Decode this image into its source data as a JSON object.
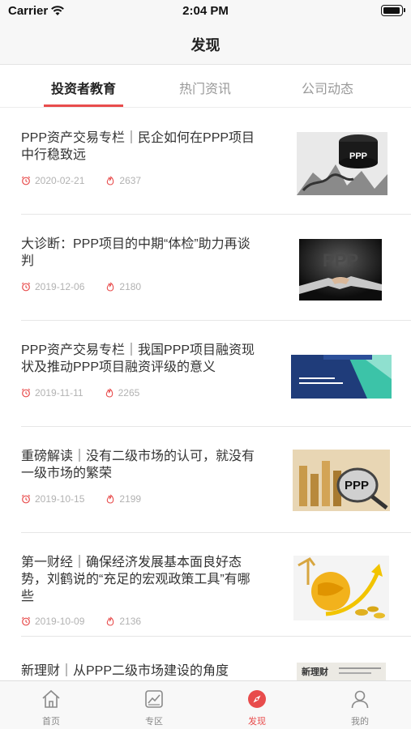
{
  "status": {
    "carrier": "Carrier",
    "time": "2:04 PM"
  },
  "nav": {
    "title": "发现"
  },
  "tabs": [
    "投资者教育",
    "热门资讯",
    "公司动态"
  ],
  "articles": [
    {
      "title": "PPP资产交易专栏｜民企如何在PPP项目中行稳致远",
      "date": "2020-02-21",
      "views": "2637",
      "image_text": "PPP"
    },
    {
      "title": "大诊断：PPP项目的中期“体检”助力再谈判",
      "date": "2019-12-06",
      "views": "2180",
      "image_text": "PPP"
    },
    {
      "title": "PPP资产交易专栏｜我国PPP项目融资现状及推动PPP项目融资评级的意义",
      "date": "2019-11-11",
      "views": "2265",
      "image_text": ""
    },
    {
      "title": "重磅解读｜没有二级市场的认可，就没有一级市场的繁荣",
      "date": "2019-10-15",
      "views": "2199",
      "image_text": "PPP"
    },
    {
      "title": "第一财经｜确保经济发展基本面良好态势，刘鹤说的“充足的宏观政策工具”有哪些",
      "date": "2019-10-09",
      "views": "2136",
      "image_text": ""
    },
    {
      "title": "新理财｜从PPP二级市场建设的角度",
      "date": "",
      "views": "",
      "image_text": "新理财"
    }
  ],
  "tabbar": [
    {
      "label": "首页",
      "icon": "home-icon"
    },
    {
      "label": "专区",
      "icon": "chart-board-icon"
    },
    {
      "label": "发现",
      "icon": "compass-icon"
    },
    {
      "label": "我的",
      "icon": "person-icon"
    }
  ],
  "colors": {
    "accent": "#e84c4c",
    "meta": "#b2b2b2",
    "title": "#333333"
  }
}
